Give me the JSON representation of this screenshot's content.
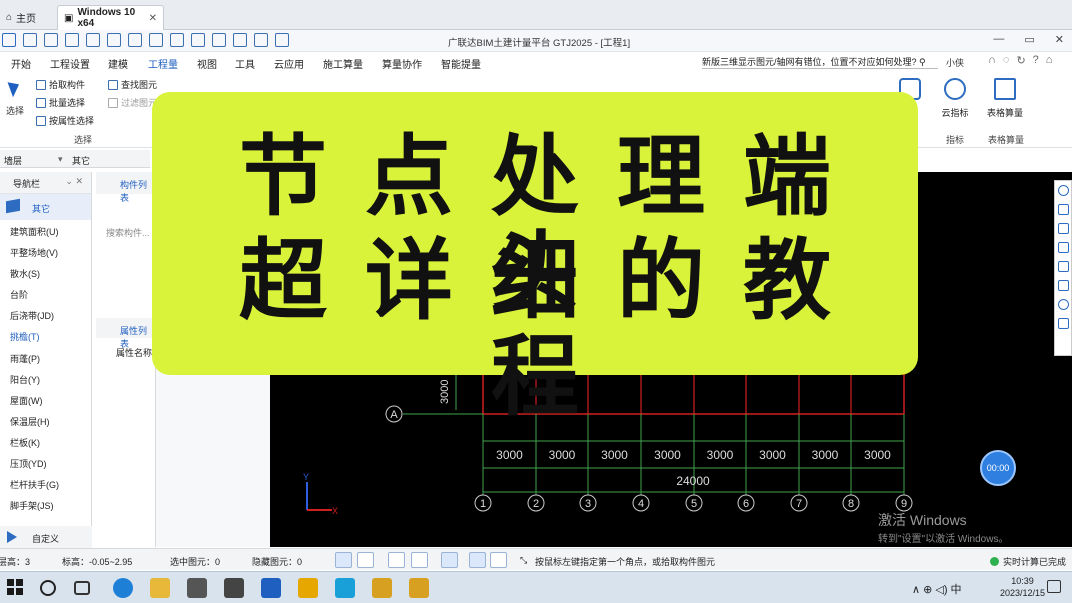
{
  "vm_tabs": [
    {
      "label": "主页"
    },
    {
      "label": "Windows 10 x64"
    }
  ],
  "title_bar": {
    "title": "广联达BIM土建计量平台 GTJ2025 - [工程1]",
    "controls": [
      "—",
      "▭",
      "✕"
    ]
  },
  "menu": {
    "items": [
      "开始",
      "工程设置",
      "建模",
      "工程量",
      "视图",
      "工具",
      "云应用",
      "施工算量",
      "算量协作",
      "智能提量"
    ],
    "active": "工程量",
    "hint": "新版三维显示图元/轴网有错位，位置不对应如何处理?",
    "user": "小侠"
  },
  "ribbon": {
    "select_label": "选择",
    "small_buttons": [
      "拾取构件",
      "批量选择",
      "按属性选择",
      "查找图元",
      "过滤图元"
    ],
    "group_select": "选择",
    "right_buttons": [
      "云指标",
      "表格算量"
    ],
    "right_groups": [
      "指标",
      "表格算量"
    ],
    "partial_group": "表"
  },
  "left": {
    "dropdown_left": "墙层",
    "dropdown_right": "其它",
    "nav_title": "导航栏",
    "nav_category": "其它",
    "nav_items": [
      "建筑面积(U)",
      "平整场地(V)",
      "散水(S)",
      "台阶",
      "后浇带(JD)",
      "挑檐(T)",
      "雨蓬(P)",
      "阳台(Y)",
      "屋面(W)",
      "保温层(H)",
      "栏板(K)",
      "压顶(YD)",
      "栏杆扶手(G)",
      "脚手架(JS)"
    ],
    "nav_highlight": 5,
    "nav_custom": "自定义",
    "component_list": "构件列表",
    "component_search": "搜索构件...",
    "property_list": "属性列表",
    "property_col": "属性名称"
  },
  "canvas": {
    "axis_label": "A",
    "vertical_dim": "3000",
    "dims": [
      "3000",
      "3000",
      "3000",
      "3000",
      "3000",
      "3000",
      "3000",
      "3000"
    ],
    "total_dim": "24000",
    "grid_numbers": [
      "1",
      "2",
      "3",
      "4",
      "5",
      "6",
      "7",
      "8",
      "9"
    ],
    "axis_x": "X",
    "axis_y": "Y",
    "timer": "00:00",
    "watermark": "激活 Windows",
    "watermark_sub": "转到\"设置\"以激活 Windows。"
  },
  "status_bar": {
    "layer_height": "层高：3",
    "elevation": "标高：-0.05~2.95",
    "selected": "选中图元：0",
    "hidden": "隐藏图元：0",
    "tip": "按鼠标左键指定第一个角点，或拾取构件图元",
    "realtime": "实时计算已完成"
  },
  "taskbar": {
    "tray": "∧ ⊕ ◁) 中",
    "time": "10:39",
    "date": "2023/12/15"
  },
  "banner": {
    "line1": "节点处理端头",
    "line2": "超详细的教程",
    "bg_color": "#d9f23a"
  }
}
